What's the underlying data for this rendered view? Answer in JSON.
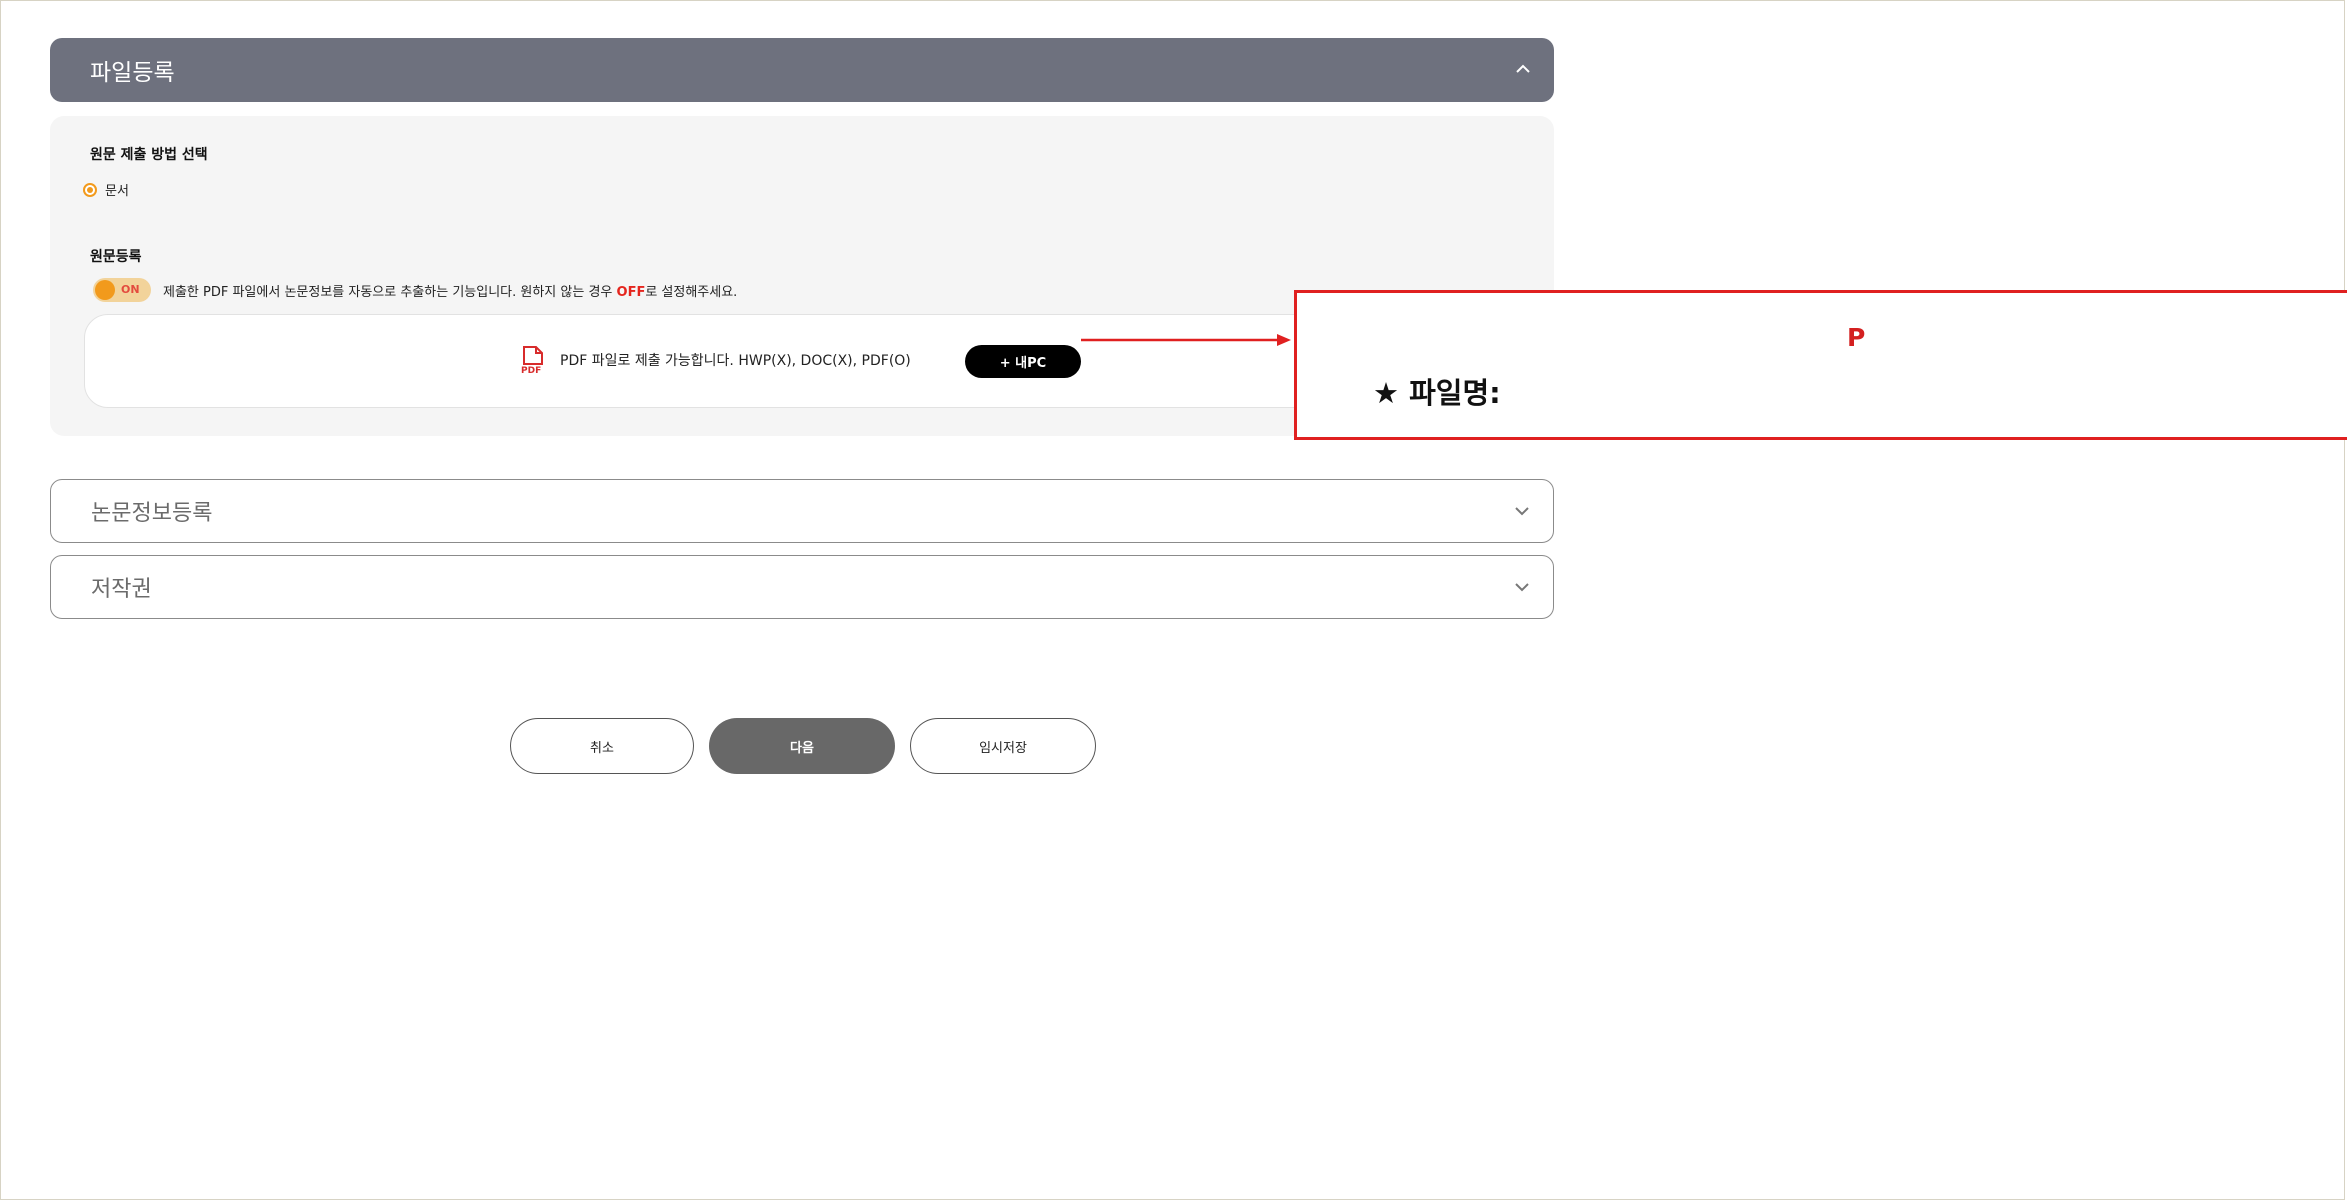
{
  "file_panel": {
    "title": "파일등록",
    "method_title": "원문 제출 방법 선택",
    "method_option": "문서",
    "register_title": "원문등록",
    "toggle_label": "ON",
    "toggle_desc_prefix": "제출한 PDF 파일에서 논문정보를 자동으로 추출하는 기능입니다. 원하지 않는 경우 ",
    "toggle_desc_off": "OFF",
    "toggle_desc_suffix": "로 설정해주세요.",
    "upload_hint": "PDF 파일로 제출 가능합니다. HWP(X), DOC(X), PDF(O)",
    "my_pc_button": "+ 내PC"
  },
  "callout": {
    "line1": "P",
    "line2": "★ 파일명:"
  },
  "accordions": {
    "paper_info": "논문정보등록",
    "copyright": "저작권"
  },
  "buttons": {
    "cancel": "취소",
    "next": "다음",
    "temp_save": "임시저장"
  },
  "colors": {
    "header_bg": "#6e717e",
    "accent_orange": "#f29a1c",
    "off_red": "#e5261e",
    "callout_red": "#e02020",
    "next_button": "#686868"
  }
}
